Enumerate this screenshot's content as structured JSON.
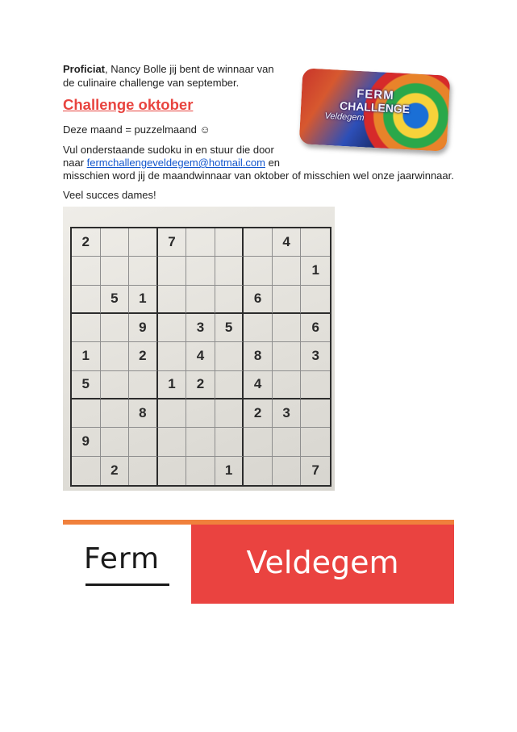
{
  "intro": {
    "bold": "Proficiat",
    "line1_rest": ", Nancy Bolle jij bent de winnaar van",
    "line2": "de culinaire challenge van september."
  },
  "heading": "Challenge oktober",
  "subtitle": "Deze maand = puzzelmaand ☺",
  "body": {
    "line1": "Vul onderstaande sudoku in en stuur die door",
    "line2_prefix": "naar ",
    "email": "fermchallengeveldegem@hotmail.com",
    "line2_suffix": " en",
    "line3": "misschien word jij de maandwinnaar van oktober of misschien wel onze jaarwinnaar."
  },
  "closing": "Veel succes dames!",
  "badge": {
    "line1": "FERM",
    "line2": "CHALLENGE",
    "line3": "Veldegem"
  },
  "sudoku": [
    [
      "2",
      "",
      "",
      "7",
      "",
      "",
      "",
      "4",
      ""
    ],
    [
      "",
      "",
      "",
      "",
      "",
      "",
      "",
      "",
      "1"
    ],
    [
      "",
      "5",
      "1",
      "",
      "",
      "",
      "6",
      "",
      ""
    ],
    [
      "",
      "",
      "9",
      "",
      "3",
      "5",
      "",
      "",
      "6"
    ],
    [
      "1",
      "",
      "2",
      "",
      "4",
      "",
      "8",
      "",
      "3"
    ],
    [
      "5",
      "",
      "",
      "1",
      "2",
      "",
      "4",
      "",
      ""
    ],
    [
      "",
      "",
      "8",
      "",
      "",
      "",
      "2",
      "3",
      ""
    ],
    [
      "9",
      "",
      "",
      "",
      "",
      "",
      "",
      "",
      ""
    ],
    [
      "",
      "2",
      "",
      "",
      "",
      "1",
      "",
      "",
      "7"
    ]
  ],
  "footer": {
    "left": "Ferm",
    "right": "Veldegem",
    "colors": {
      "stripe": "#f0803c",
      "red": "#ea4340"
    }
  }
}
